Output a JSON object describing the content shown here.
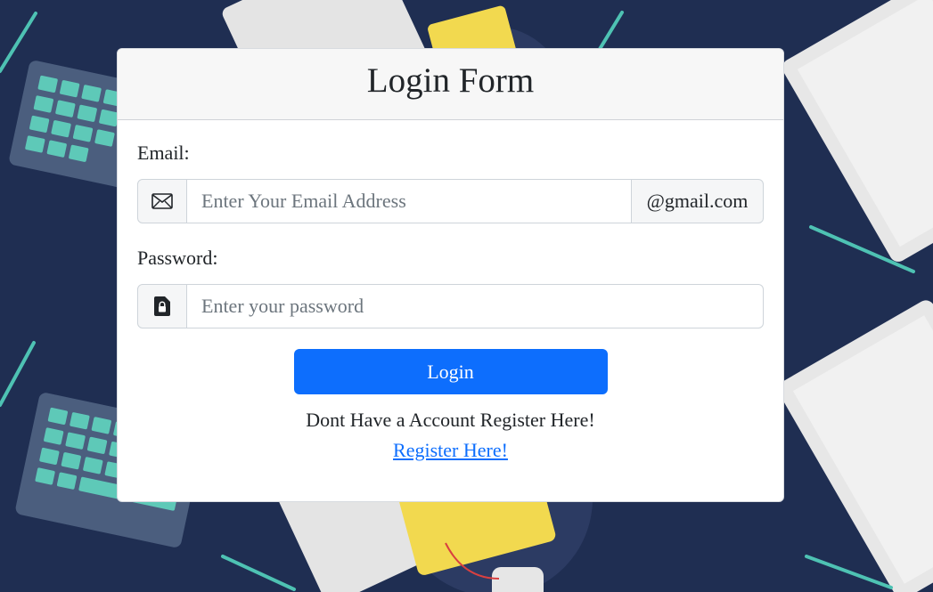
{
  "form": {
    "title": "Login Form",
    "email": {
      "label": "Email:",
      "placeholder": "Enter Your Email Address",
      "value": "",
      "suffix": "@gmail.com",
      "icon": "envelope-icon"
    },
    "password": {
      "label": "Password:",
      "placeholder": "Enter your password",
      "value": "",
      "icon": "file-lock-icon"
    },
    "submit_label": "Login",
    "register_prompt": "Dont Have a Account Register Here!",
    "register_link": "Register Here!"
  },
  "colors": {
    "background": "#1f2e52",
    "primary": "#0d6efd",
    "card_header": "#f7f7f7"
  }
}
